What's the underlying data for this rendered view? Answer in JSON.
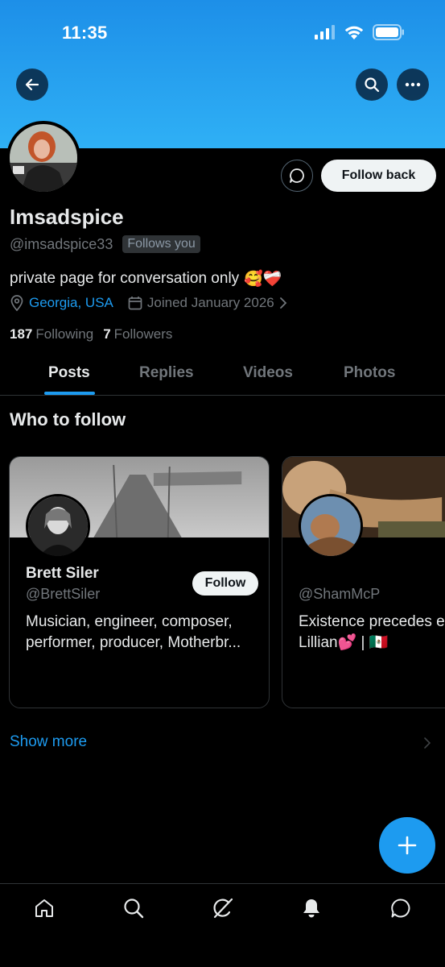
{
  "status_bar": {
    "time": "11:35"
  },
  "header": {
    "back_icon": "arrow-left-icon",
    "search_icon": "search-icon",
    "more_icon": "more-horizontal-icon"
  },
  "profile": {
    "display_name": "Imsadspice",
    "handle": "@imsadspice33",
    "follows_you": "Follows you",
    "bio": "private page for conversation only",
    "bio_emojis": "🥰❤️‍🩹",
    "location": "Georgia, USA",
    "joined": "Joined January 2026",
    "following_count": "187",
    "following_label": "Following",
    "followers_count": "7",
    "followers_label": "Followers",
    "follow_back_label": "Follow back"
  },
  "tabs": [
    {
      "label": "Posts",
      "active": true
    },
    {
      "label": "Replies",
      "active": false
    },
    {
      "label": "Videos",
      "active": false
    },
    {
      "label": "Photos",
      "active": false
    }
  ],
  "who_to_follow": {
    "title": "Who to follow",
    "cards": [
      {
        "name": "Brett Siler",
        "handle": "@BrettSiler",
        "bio": "Musician, engineer, composer, performer, producer, Motherbr...",
        "follow_label": "Follow"
      },
      {
        "name": "",
        "handle": "@ShamMcP",
        "bio": "Existence precedes e Lillian💕 | 🇲🇽"
      }
    ],
    "show_more": "Show more"
  },
  "colors": {
    "accent": "#1d9bf0",
    "background": "#000000",
    "banner": "#28a3f0",
    "muted": "#71767b"
  },
  "bottom_nav": [
    "home-icon",
    "search-icon",
    "grok-icon",
    "notifications-bell-icon",
    "messages-icon"
  ]
}
